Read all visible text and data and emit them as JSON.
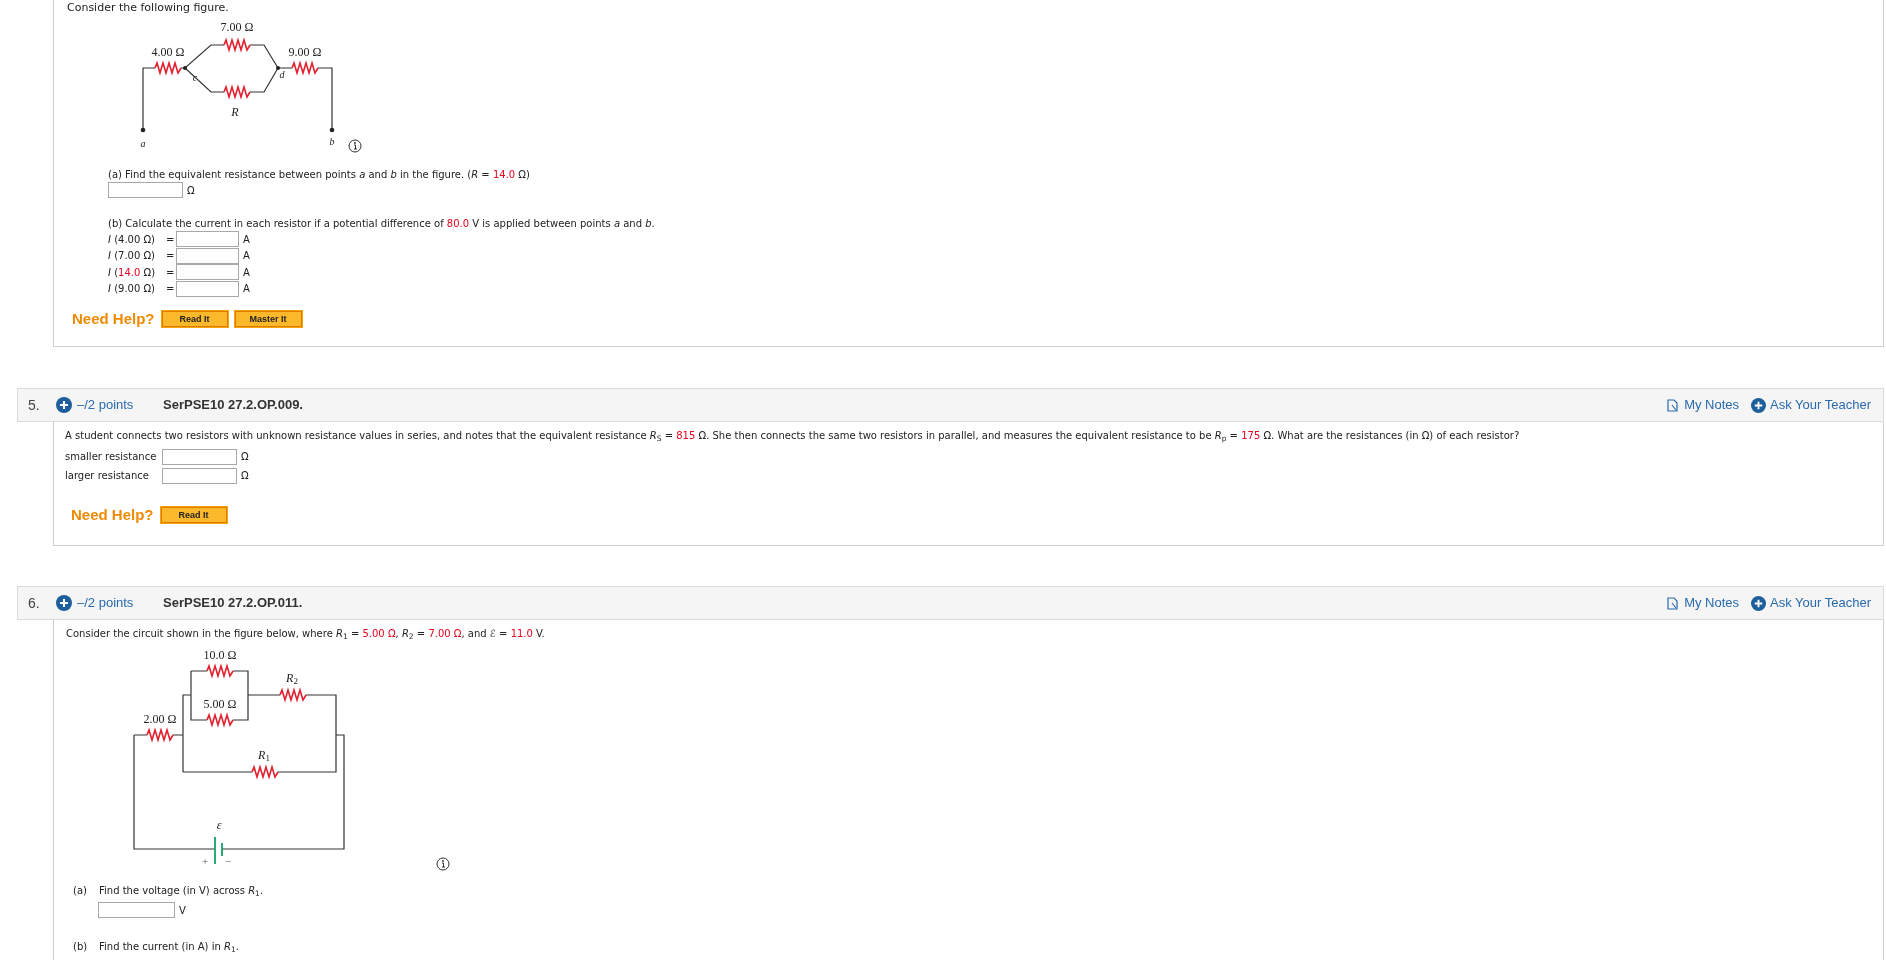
{
  "q4": {
    "intro": "Consider the following figure.",
    "figure_labels": [
      "7.00 Ω",
      "4.00 Ω",
      "9.00 Ω",
      "*R*",
      "*a*",
      "*b*",
      "*c*",
      "*d*"
    ],
    "part_a": {
      "prompt": [
        {
          "text": "(a) Find the equivalent resistance between points *a* and *b* in the figure. (*R* = ",
          "red": false
        },
        {
          "text": "14.0",
          "red": true
        },
        {
          "text": " Ω)",
          "red": false
        }
      ],
      "unit": "Ω"
    },
    "part_b": {
      "prompt": [
        {
          "text": "(b) Calculate the current in each resistor if a potential difference of ",
          "red": false
        },
        {
          "text": "80.0",
          "red": true
        },
        {
          "text": " V is applied between points *a* and *b*.",
          "red": false
        }
      ],
      "rows": [
        {
          "label": [
            {
              "text": "*I* (4.00 Ω)",
              "red": false
            }
          ],
          "equals": "=",
          "unit": "A"
        },
        {
          "label": [
            {
              "text": "*I* (7.00 Ω)",
              "red": false
            }
          ],
          "equals": "=",
          "unit": "A"
        },
        {
          "label": [
            {
              "text": "*I* (",
              "red": false
            },
            {
              "text": "14.0",
              "red": true
            },
            {
              "text": " Ω)",
              "red": false
            }
          ],
          "equals": "=",
          "unit": "A"
        },
        {
          "label": [
            {
              "text": "*I* (9.00 Ω)",
              "red": false
            }
          ],
          "equals": "=",
          "unit": "A"
        }
      ]
    },
    "help": {
      "label": "Need Help?",
      "buttons": [
        "Read It",
        "Master It"
      ]
    }
  },
  "q5": {
    "number": "5.",
    "points": "–/2 points",
    "code": "SerPSE10 27.2.OP.009.",
    "notes": "My Notes",
    "ask": "Ask Your Teacher",
    "prompt": [
      {
        "text": "A student connects two resistors with unknown resistance values in series, and notes that the equivalent resistance *R*$_{S}$ = ",
        "red": false
      },
      {
        "text": "815",
        "red": true
      },
      {
        "text": " Ω. She then connects the same two resistors in parallel, and measures the equivalent resistance to be *R*$_{p}$ = ",
        "red": false
      },
      {
        "text": "175",
        "red": true
      },
      {
        "text": " Ω. What are the resistances (in Ω) of each resistor?",
        "red": false
      }
    ],
    "answers": [
      {
        "label": "smaller resistance",
        "unit": "Ω"
      },
      {
        "label": "larger resistance",
        "unit": "Ω"
      }
    ],
    "help": {
      "label": "Need Help?",
      "buttons": [
        "Read It"
      ]
    }
  },
  "q6": {
    "number": "6.",
    "points": "–/2 points",
    "code": "SerPSE10 27.2.OP.011.",
    "notes": "My Notes",
    "ask": "Ask Your Teacher",
    "prompt": [
      {
        "text": "Consider the circuit shown in the figure below, where *R*$_{1}$ = ",
        "red": false
      },
      {
        "text": "5.00 Ω",
        "red": true
      },
      {
        "text": ", *R*$_{2}$ = ",
        "red": false
      },
      {
        "text": "7.00 Ω",
        "red": true
      },
      {
        "text": ", and ℰ = ",
        "red": false
      },
      {
        "text": "11.0",
        "red": true
      },
      {
        "text": " V.",
        "red": false
      }
    ],
    "figure_labels": [
      "10.0 Ω",
      "5.00 Ω",
      "*R*$_{2}$",
      "2.00 Ω",
      "*R*$_{1}$",
      "*ε*",
      "+",
      "−"
    ],
    "parts": [
      {
        "letter": "(a)",
        "prompt": [
          {
            "text": "Find the voltage (in V) across *R*$_{1}$.",
            "red": false
          }
        ],
        "unit": "V"
      },
      {
        "letter": "(b)",
        "prompt": [
          {
            "text": "Find the current (in A) in *R*$_{1}$.",
            "red": false
          }
        ]
      }
    ]
  }
}
